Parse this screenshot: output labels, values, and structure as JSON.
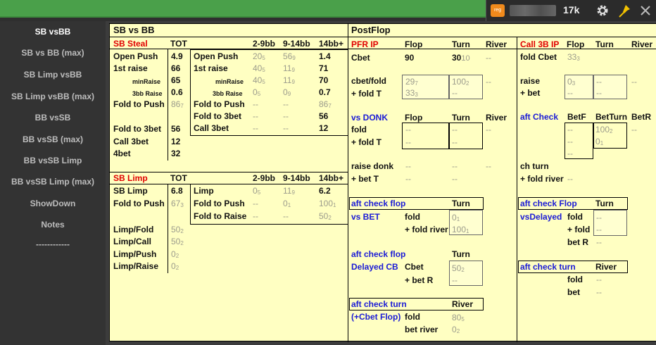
{
  "topbar": {
    "reg_badge": "reg",
    "count": "17k",
    "icons": [
      "gear-icon",
      "pin-icon",
      "close-icon"
    ],
    "accent_color": "#f08a1c"
  },
  "sidebar": {
    "items": [
      "SB vsBB",
      "SB vs BB (max)",
      "SB Limp vsBB",
      "SB Limp vsBB (max)",
      "BB vsSB",
      "BB vsSB (max)",
      "BB vsSB Limp",
      "BB vsSB Limp (max)",
      "ShowDown",
      "Notes",
      "------------"
    ]
  },
  "panel": {
    "title": "SB vs BB",
    "postflop_title": "PostFlop"
  },
  "sbsteal": {
    "title": "SB Steal",
    "tot": "TOT",
    "c1": "2-9bb",
    "c2": "9-14bb",
    "c3": "14bb+",
    "labels": [
      "Open Push",
      "1st raise",
      "minRaise",
      "3bb Raise",
      "Fold to Push",
      "Fold to 3bet",
      "Call 3bet",
      "4bet"
    ],
    "values": [
      "4.9",
      "66",
      "65",
      "0.6",
      "86",
      "56",
      "12",
      "32"
    ],
    "fold_push_sub": "7",
    "right_labels": [
      "Open Push",
      "1st raise",
      "minRaise",
      "3bb Raise",
      "Fold to Push",
      "Fold to 3bet",
      "Call 3bet"
    ],
    "col1": [
      "20",
      "40",
      "40",
      "0",
      "--",
      "--",
      "--"
    ],
    "col1_sub": [
      "5",
      "5",
      "5",
      "5",
      "",
      "",
      ""
    ],
    "col2": [
      "56",
      "11",
      "11",
      "0",
      "--",
      "--",
      "--"
    ],
    "col2_sub": [
      "9",
      "9",
      "9",
      "9",
      "",
      "",
      ""
    ],
    "col3": [
      "1.4",
      "71",
      "70",
      "0.7",
      "86",
      "56",
      "12"
    ],
    "col3_sub": [
      "",
      "",
      "",
      "",
      "7",
      "",
      ""
    ]
  },
  "sblimp": {
    "title": "SB Limp",
    "tot": "TOT",
    "c1": "2-9bb",
    "c2": "9-14bb",
    "c3": "14bb+",
    "labels": [
      "SB Limp",
      "Fold to Push",
      "Limp/Fold",
      "Limp/Call",
      "Limp/Push",
      "Limp/Raise"
    ],
    "values": [
      "6.8",
      "67",
      "50",
      "50",
      "0",
      "0"
    ],
    "values_sub": [
      "",
      "3",
      "2",
      "2",
      "2",
      "2"
    ],
    "right_labels": [
      "Limp",
      "Fold to Push",
      "Fold to Raise"
    ],
    "col1": [
      "0",
      "--",
      "--"
    ],
    "col1_sub": [
      "5",
      "",
      ""
    ],
    "col2": [
      "11",
      "0",
      "--"
    ],
    "col2_sub": [
      "9",
      "1",
      ""
    ],
    "col3": [
      "6.2",
      "100",
      "50"
    ],
    "col3_sub": [
      "",
      "1",
      "2"
    ]
  },
  "pfrip": {
    "title": "PFR IP",
    "flop": "Flop",
    "turn": "Turn",
    "river": "River",
    "cbet": "Cbet",
    "cbet_flop": "90",
    "cbet_turn": "30",
    "cbet_turn_sub": "10",
    "cbet_river": "--",
    "cbetfold": "cbet/fold",
    "foldt": "+ fold T",
    "cf_flop1": "29",
    "cf_flop1_sub": "7",
    "cf_flop2": "33",
    "cf_flop2_sub": "3",
    "cf_turn1": "100",
    "cf_turn1_sub": "2",
    "cf_turn2": "--",
    "cf_river": "--",
    "vsdonk": "vs DONK",
    "vd_flop": "Flop",
    "vd_turn": "Turn",
    "vd_river": "River",
    "vd_fold": "fold",
    "vd_foldt": "+ fold T",
    "vd_dash": "--",
    "raisedonk": "raise donk",
    "betT": "+ bet T",
    "dash": "--"
  },
  "acf1": {
    "title": "aft check flop",
    "turn": "Turn",
    "vsbet": "vs BET",
    "fold": "fold",
    "foldriver": "+ fold river",
    "v1": "0",
    "v1_sub": "1",
    "v2": "100",
    "v2_sub": "1"
  },
  "acf2": {
    "title": "aft check flop",
    "turn": "Turn",
    "delayed": "Delayed CB",
    "cbet": "Cbet",
    "betr": "+ bet R",
    "v1": "50",
    "v1_sub": "2",
    "v2": "--"
  },
  "act": {
    "title": "aft check turn",
    "river": "River",
    "cbetflop": "(+Cbet Flop)",
    "fold": "fold",
    "betriver": "bet river",
    "v1": "80",
    "v1_sub": "5",
    "v2": "0",
    "v2_sub": "2"
  },
  "call3b": {
    "title": "Call 3B IP",
    "flop": "Flop",
    "turn": "Turn",
    "river": "River",
    "foldcbet": "fold Cbet",
    "fc_flop": "33",
    "fc_flop_sub": "3",
    "raise": "raise",
    "bet": "+ bet",
    "r_flop": "0",
    "r_flop_sub": "3",
    "dash": "--",
    "aftcheck": "aft Check",
    "betf": "BetF",
    "betturn": "BetTurn",
    "betr": "BetR",
    "bt_v1": "100",
    "bt_v1_sub": "2",
    "bt_v2": "0",
    "bt_v2_sub": "1",
    "chturn": "ch turn",
    "foldriver": "+ fold river"
  },
  "acflop2": {
    "title": "aft check Flop",
    "turn": "Turn",
    "vsdelayed": "vsDelayed",
    "fold": "fold",
    "pfold": "+ fold",
    "betr": "bet R",
    "dash": "--"
  },
  "acturn2": {
    "title": "aft check turn",
    "river": "River",
    "fold": "fold",
    "bet": "bet",
    "dash": "--"
  }
}
